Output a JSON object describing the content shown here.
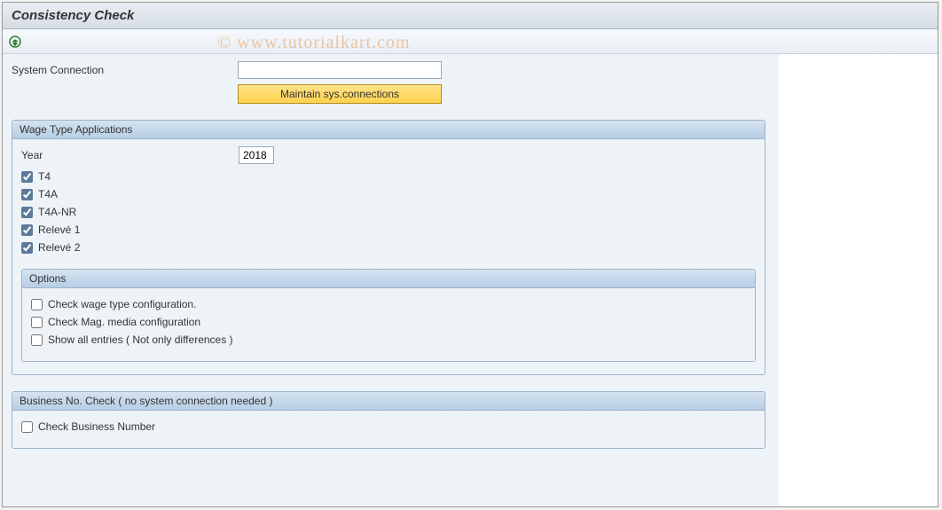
{
  "title": "Consistency Check",
  "watermark": "© www.tutorialkart.com",
  "systemConnection": {
    "label": "System Connection",
    "value": "",
    "maintainBtn": "Maintain sys.connections"
  },
  "wageTypeApps": {
    "header": "Wage Type Applications",
    "yearLabel": "Year",
    "yearValue": "2018",
    "items": [
      {
        "label": "T4",
        "checked": true
      },
      {
        "label": "T4A",
        "checked": true
      },
      {
        "label": "T4A-NR",
        "checked": true
      },
      {
        "label": "Relevé 1",
        "checked": true
      },
      {
        "label": "Relevé 2",
        "checked": true
      }
    ],
    "options": {
      "header": "Options",
      "items": [
        {
          "label": "Check wage type configuration.",
          "checked": false
        },
        {
          "label": "Check Mag. media configuration",
          "checked": false
        },
        {
          "label": "Show all entries ( Not only differences )",
          "checked": false
        }
      ]
    }
  },
  "businessNoCheck": {
    "header": "Business No. Check ( no system connection needed )",
    "items": [
      {
        "label": "Check Business Number",
        "checked": false
      }
    ]
  }
}
